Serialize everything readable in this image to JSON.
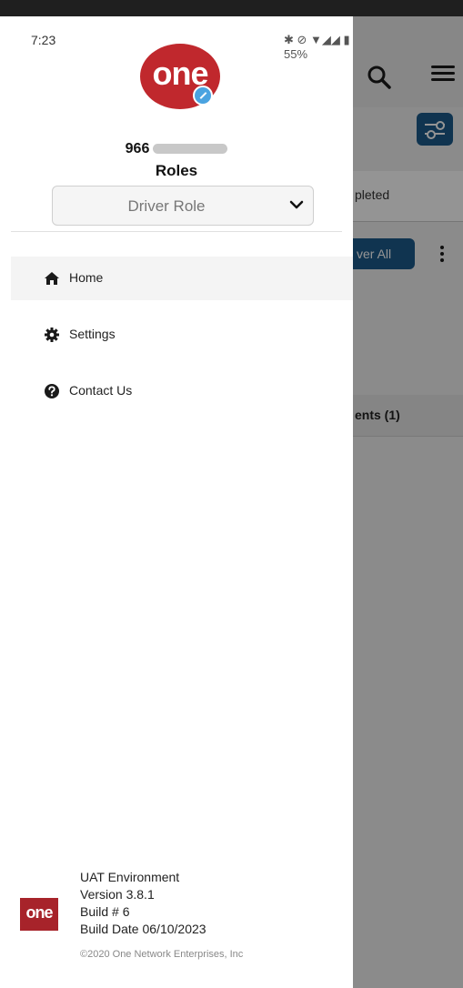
{
  "status_bar": {
    "time": "7:23",
    "icons_text": "✱ ⊘ ▼◢◢ ▮ 55%",
    "battery": "55%"
  },
  "background_app": {
    "tab_partial": "pleted",
    "action_button_partial": "ver All",
    "section_partial": "ents (1)"
  },
  "drawer": {
    "logo_text": "one",
    "user": {
      "name_prefix": "966"
    },
    "roles_label": "Roles",
    "role_select": {
      "value": "Driver Role"
    },
    "nav": [
      {
        "label": "Home",
        "icon": "home-icon"
      },
      {
        "label": "Settings",
        "icon": "gear-icon"
      },
      {
        "label": "Contact Us",
        "icon": "question-circle-icon"
      }
    ],
    "footer": {
      "logo_text": "one",
      "environment": "UAT Environment",
      "version": "Version 3.8.1",
      "build": "Build # 6",
      "build_date": "Build Date 06/10/2023",
      "copyright": "©2020 One Network Enterprises, Inc"
    }
  },
  "colors": {
    "brand_red": "#c0282d",
    "accent_blue": "#1c5a8a",
    "badge_blue": "#4aa3e0"
  }
}
